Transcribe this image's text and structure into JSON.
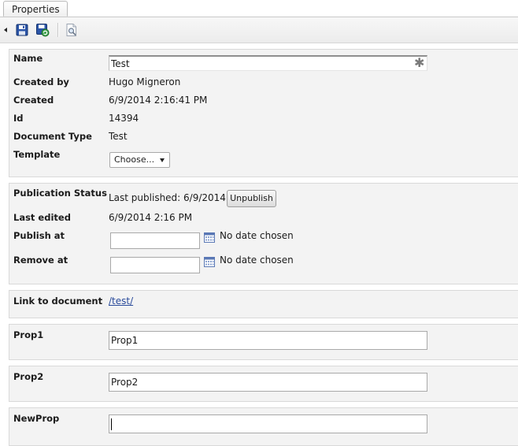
{
  "tabs": [
    {
      "label": "Properties"
    }
  ],
  "toolbar": {
    "icons": [
      "save-icon",
      "save-and-publish-icon",
      "preview-icon"
    ]
  },
  "document_info": {
    "name_label": "Name",
    "name_value": "Test",
    "required_marker": "✱",
    "created_by_label": "Created by",
    "created_by_value": "Hugo Migneron",
    "created_label": "Created",
    "created_value": "6/9/2014 2:16:41 PM",
    "id_label": "Id",
    "id_value": "14394",
    "doc_type_label": "Document Type",
    "doc_type_value": "Test",
    "template_label": "Template",
    "template_selected": "Choose..."
  },
  "publication": {
    "status_label": "Publication Status",
    "status_value": "Last published: 6/9/2014",
    "unpublish_label": "Unpublish",
    "last_edited_label": "Last edited",
    "last_edited_value": "6/9/2014 2:16 PM",
    "publish_at_label": "Publish at",
    "publish_at_value": "",
    "publish_at_status": "No date chosen",
    "remove_at_label": "Remove at",
    "remove_at_value": "",
    "remove_at_status": "No date chosen"
  },
  "link": {
    "label": "Link to document",
    "url_text": "/test/"
  },
  "properties": [
    {
      "label": "Prop1",
      "value": "Prop1"
    },
    {
      "label": "Prop2",
      "value": "Prop2"
    },
    {
      "label": "NewProp",
      "value": ""
    }
  ],
  "colors": {
    "panel_bg": "#f3f3f3",
    "link": "#2a4b9b",
    "border": "#d9d9d9"
  }
}
